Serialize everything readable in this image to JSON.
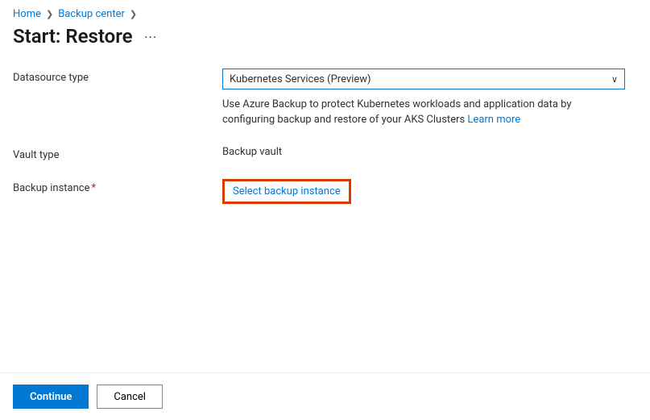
{
  "breadcrumb": {
    "home": "Home",
    "backup_center": "Backup center"
  },
  "title": "Start: Restore",
  "form": {
    "datasource_type": {
      "label": "Datasource type",
      "selected": "Kubernetes Services (Preview)",
      "help_text": "Use Azure Backup to protect Kubernetes workloads and application data by configuring backup and restore of your AKS Clusters ",
      "learn_more": "Learn more"
    },
    "vault_type": {
      "label": "Vault type",
      "value": "Backup vault"
    },
    "backup_instance": {
      "label": "Backup instance",
      "action": "Select backup instance"
    }
  },
  "footer": {
    "continue": "Continue",
    "cancel": "Cancel"
  }
}
